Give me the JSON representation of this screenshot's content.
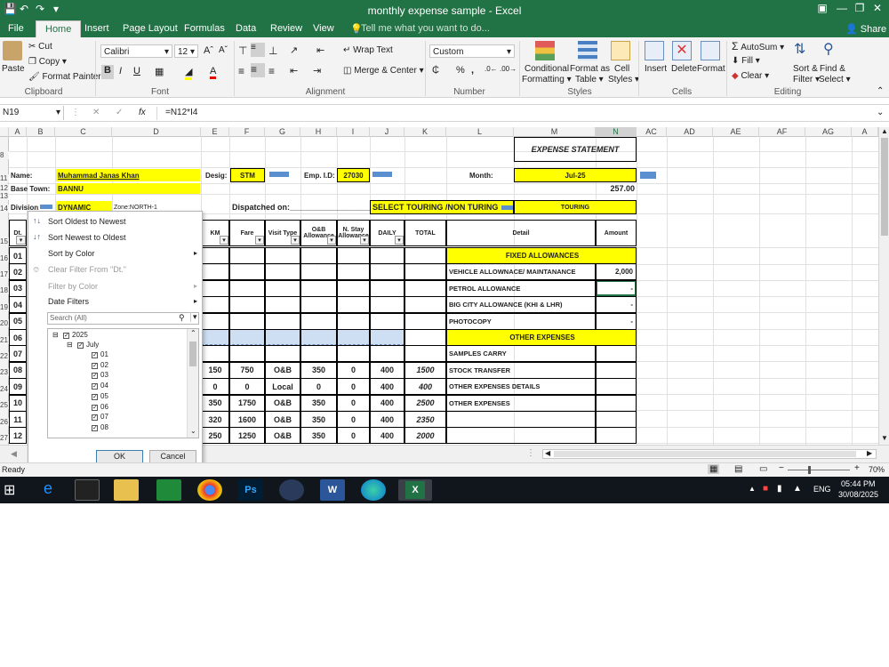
{
  "app": {
    "title": "monthly expense sample - Excel",
    "share": "Share",
    "tell_me": "Tell me what you want to do..."
  },
  "tabs": [
    "File",
    "Home",
    "Insert",
    "Page Layout",
    "Formulas",
    "Data",
    "Review",
    "View"
  ],
  "ribbon": {
    "clipboard": {
      "paste": "Paste",
      "cut": "Cut",
      "copy": "Copy",
      "format_painter": "Format Painter",
      "label": "Clipboard"
    },
    "font": {
      "name": "Calibri",
      "size": "12",
      "label": "Font"
    },
    "alignment": {
      "wrap": "Wrap Text",
      "merge": "Merge & Center",
      "label": "Alignment"
    },
    "number": {
      "format": "Custom",
      "label": "Number"
    },
    "styles": {
      "cond": "Conditional",
      "cond2": "Formatting",
      "fmt_table": "Format as",
      "fmt_table2": "Table",
      "cell_styles": "Cell",
      "cell_styles2": "Styles",
      "label": "Styles"
    },
    "cells": {
      "insert": "Insert",
      "delete": "Delete",
      "format": "Format",
      "label": "Cells"
    },
    "editing": {
      "autosum": "AutoSum",
      "fill": "Fill",
      "clear": "Clear",
      "sort": "Sort &",
      "sort2": "Filter",
      "find": "Find &",
      "find2": "Select",
      "label": "Editing"
    }
  },
  "formula_bar": {
    "name_box": "N19",
    "fx": "fx",
    "formula": "=N12*I4"
  },
  "columns": [
    "A",
    "B",
    "C",
    "D",
    "E",
    "F",
    "G",
    "H",
    "I",
    "J",
    "K",
    "L",
    "M",
    "N",
    "AC",
    "AD",
    "AE",
    "AF",
    "AG",
    "A"
  ],
  "rows": [
    "8",
    "9",
    "11",
    "12",
    "13",
    "14",
    "15",
    "16",
    "17",
    "18",
    "19",
    "20",
    "21",
    "22",
    "23",
    "24",
    "25",
    "26",
    "27",
    "28"
  ],
  "sheet": {
    "title": "EXPENSE STATEMENT",
    "name_label": "Name:",
    "name": "Muhammad Janas Khan",
    "desig_label": "Desig:",
    "desig": "STM",
    "emp_label": "Emp. I.D:",
    "emp": "27030",
    "month_label": "Month:",
    "month": "Jul-25",
    "base_label": "Base Town:",
    "base": "BANNU",
    "total_top": "257.00",
    "division_label": "Division:",
    "division": "DYNAMIC",
    "zone": "Zone:NORTH-1",
    "dispatched": "Dispatched on:___________________",
    "select_touring": "SELECT TOURING /NON TURING",
    "touring": "TOURING",
    "headers": {
      "dt": "Dt.",
      "km": "KM",
      "fare": "Fare",
      "visit": "Visit Type",
      "ob": "O&B Allowance",
      "nstay": "N. Stay Allowance",
      "daily": "DAILY",
      "total": "TOTAL",
      "detail": "Detail",
      "amount": "Amount"
    },
    "day_rows": [
      {
        "d": "01",
        "km": "",
        "fare": "",
        "visit": "",
        "ob": "",
        "ns": "",
        "daily": "",
        "total": ""
      },
      {
        "d": "02",
        "km": "",
        "fare": "",
        "visit": "",
        "ob": "",
        "ns": "",
        "daily": "",
        "total": ""
      },
      {
        "d": "03",
        "km": "",
        "fare": "",
        "visit": "",
        "ob": "",
        "ns": "",
        "daily": "",
        "total": ""
      },
      {
        "d": "04",
        "km": "",
        "fare": "",
        "visit": "",
        "ob": "",
        "ns": "",
        "daily": "",
        "total": ""
      },
      {
        "d": "05",
        "km": "",
        "fare": "",
        "visit": "",
        "ob": "",
        "ns": "",
        "daily": "",
        "total": ""
      },
      {
        "d": "06",
        "km": "",
        "fare": "",
        "visit": "",
        "ob": "",
        "ns": "",
        "daily": "",
        "total": ""
      },
      {
        "d": "07",
        "km": "",
        "fare": "",
        "visit": "",
        "ob": "",
        "ns": "",
        "daily": "",
        "total": ""
      },
      {
        "d": "08",
        "km": "150",
        "fare": "750",
        "visit": "O&B",
        "ob": "350",
        "ns": "0",
        "daily": "400",
        "total": "1500"
      },
      {
        "d": "09",
        "km": "0",
        "fare": "0",
        "visit": "Local",
        "ob": "0",
        "ns": "0",
        "daily": "400",
        "total": "400"
      },
      {
        "d": "10",
        "km": "350",
        "fare": "1750",
        "visit": "O&B",
        "ob": "350",
        "ns": "0",
        "daily": "400",
        "total": "2500"
      },
      {
        "d": "11",
        "km": "320",
        "fare": "1600",
        "visit": "O&B",
        "ob": "350",
        "ns": "0",
        "daily": "400",
        "total": "2350"
      },
      {
        "d": "12",
        "km": "250",
        "fare": "1250",
        "visit": "O&B",
        "ob": "350",
        "ns": "0",
        "daily": "400",
        "total": "2000"
      }
    ],
    "right_rows": [
      {
        "detail": "FIXED ALLOWANCES",
        "amount": "",
        "hl": true
      },
      {
        "detail": "VEHICLE ALLOWNACE/ MAINTANANCE",
        "amount": "2,000",
        "hl": false
      },
      {
        "detail": "PETROL ALLOWANCE",
        "amount": "-",
        "hl": false
      },
      {
        "detail": "BIG CITY ALLOWANCE (KHI & LHR)",
        "amount": "-",
        "hl": false
      },
      {
        "detail": "PHOTOCOPY",
        "amount": "-",
        "hl": false
      },
      {
        "detail": "OTHER EXPENSES",
        "amount": "",
        "hl": true
      },
      {
        "detail": "SAMPLES CARRY",
        "amount": "",
        "hl": false
      },
      {
        "detail": "STOCK TRANSFER",
        "amount": "",
        "hl": false
      },
      {
        "detail": "OTHER EXPENSES DETAILS",
        "amount": "",
        "hl": false
      },
      {
        "detail": "OTHER EXPENSES",
        "amount": "",
        "hl": false
      },
      {
        "detail": "",
        "amount": "",
        "hl": false
      },
      {
        "detail": "",
        "amount": "",
        "hl": false
      }
    ]
  },
  "filter_menu": {
    "sort_old": "Sort Oldest to Newest",
    "sort_new": "Sort Newest to Oldest",
    "sort_color": "Sort by Color",
    "clear": "Clear Filter From \"Dt.\"",
    "filter_color": "Filter by Color",
    "date_filters": "Date Filters",
    "search_placeholder": "Search (All)",
    "year": "2025",
    "month": "July",
    "days": [
      "01",
      "02",
      "03",
      "04",
      "05",
      "06",
      "07",
      "08"
    ],
    "ok": "OK",
    "cancel": "Cancel"
  },
  "status": {
    "ready": "Ready",
    "zoom": "70%"
  },
  "taskbar": {
    "time": "05:44 PM",
    "date": "30/08/2025",
    "lang": "ENG"
  }
}
